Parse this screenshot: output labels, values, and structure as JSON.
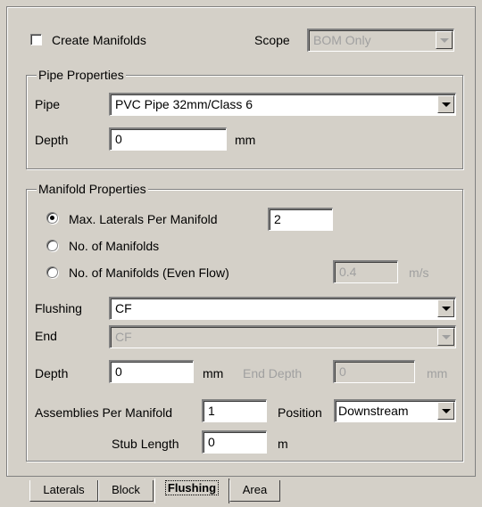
{
  "top": {
    "create_manifolds_label": "Create Manifolds",
    "create_manifolds_checked": false,
    "scope_label": "Scope",
    "scope_value": "BOM Only"
  },
  "pipe_properties": {
    "legend": "Pipe Properties",
    "pipe_label": "Pipe",
    "pipe_value": "PVC Pipe 32mm/Class 6",
    "depth_label": "Depth",
    "depth_value": "0",
    "depth_unit": "mm"
  },
  "manifold_properties": {
    "legend": "Manifold Properties",
    "radio_max_laterals_label": "Max. Laterals Per Manifold",
    "max_laterals_value": "2",
    "radio_no_manifolds_label": "No. of Manifolds",
    "radio_even_flow_label": "No. of Manifolds (Even Flow)",
    "even_flow_value": "0.4",
    "even_flow_unit": "m/s",
    "selected_radio": "max_laterals",
    "flushing_label": "Flushing",
    "flushing_value": "CF",
    "end_label": "End",
    "end_value": "CF",
    "depth_label": "Depth",
    "depth_value": "0",
    "depth_unit": "mm",
    "end_depth_label": "End Depth",
    "end_depth_value": "0",
    "end_depth_unit": "mm",
    "assemblies_label": "Assemblies Per Manifold",
    "assemblies_value": "1",
    "position_label": "Position",
    "position_value": "Downstream",
    "stub_length_label": "Stub Length",
    "stub_length_value": "0",
    "stub_length_unit": "m"
  },
  "tabs": [
    {
      "label": "Laterals",
      "active": false
    },
    {
      "label": "Block",
      "active": false
    },
    {
      "label": "Flushing",
      "active": true
    },
    {
      "label": "Area",
      "active": false
    }
  ]
}
